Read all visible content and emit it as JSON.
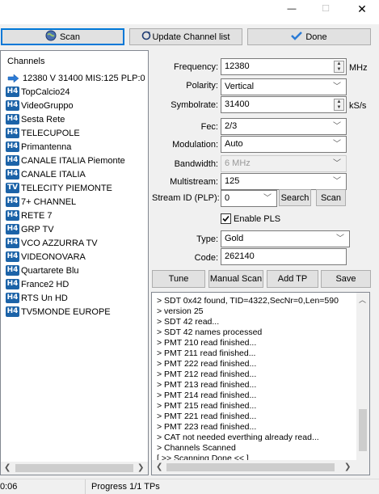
{
  "window": {
    "minimize_glyph": "—",
    "maximize_glyph": "☐",
    "close_glyph": "✕"
  },
  "toolbar": {
    "scan_label": "Scan",
    "update_label": "Update Channel list",
    "done_label": "Done"
  },
  "channels": {
    "header": "Channels",
    "transponder": "12380 V 31400 MIS:125 PLP:0",
    "items": [
      {
        "badge": "H4",
        "name": "TopCalcio24"
      },
      {
        "badge": "H4",
        "name": "VideoGruppo"
      },
      {
        "badge": "H4",
        "name": "Sesta Rete"
      },
      {
        "badge": "H4",
        "name": "TELECUPOLE"
      },
      {
        "badge": "H4",
        "name": "Primantenna"
      },
      {
        "badge": "H4",
        "name": "CANALE ITALIA Piemonte"
      },
      {
        "badge": "H4",
        "name": "CANALE ITALIA"
      },
      {
        "badge": "TV",
        "name": "TELECITY PIEMONTE"
      },
      {
        "badge": "H4",
        "name": "7+ CHANNEL"
      },
      {
        "badge": "H4",
        "name": "RETE 7"
      },
      {
        "badge": "H4",
        "name": "GRP TV"
      },
      {
        "badge": "H4",
        "name": "VCO AZZURRA TV"
      },
      {
        "badge": "H4",
        "name": "VIDEONOVARA"
      },
      {
        "badge": "H4",
        "name": "Quartarete Blu"
      },
      {
        "badge": "H4",
        "name": "France2 HD"
      },
      {
        "badge": "H4",
        "name": "RTS Un HD"
      },
      {
        "badge": "H4",
        "name": "TV5MONDE EUROPE"
      }
    ]
  },
  "form": {
    "frequency": {
      "label": "Frequency:",
      "value": "12380",
      "unit": "MHz"
    },
    "polarity": {
      "label": "Polarity:",
      "value": "Vertical"
    },
    "symbolrate": {
      "label": "Symbolrate:",
      "value": "31400",
      "unit": "kS/s"
    },
    "fec": {
      "label": "Fec:",
      "value": "2/3"
    },
    "modulation": {
      "label": "Modulation:",
      "value": "Auto"
    },
    "bandwidth": {
      "label": "Bandwidth:",
      "value": "6 MHz"
    },
    "multistream": {
      "label": "Multistream:",
      "value": "125"
    },
    "stream_id": {
      "label": "Stream ID (PLP):",
      "value": "0"
    },
    "search_label": "Search",
    "scan_label": "Scan",
    "enable_pls": {
      "label": "Enable PLS",
      "checked": true
    },
    "type": {
      "label": "Type:",
      "value": "Gold"
    },
    "code": {
      "label": "Code:",
      "value": "262140"
    }
  },
  "actions": {
    "tune": "Tune",
    "manual_scan": "Manual Scan",
    "add_tp": "Add TP",
    "save": "Save"
  },
  "log": {
    "lines": [
      ">    SDT 0x42 found, TID=4322,SecNr=0,Len=590",
      ">    version 25",
      ">    SDT 42 read...",
      ">    SDT 42 names processed",
      ">    PMT 210 read finished...",
      ">    PMT 211 read finished...",
      ">    PMT 222 read finished...",
      ">    PMT 212 read finished...",
      ">    PMT 213 read finished...",
      ">    PMT 214 read finished...",
      ">    PMT 215 read finished...",
      ">    PMT 221 read finished...",
      ">    PMT 223 read finished...",
      ">    CAT not needed everthing already read...",
      ">    Channels Scanned",
      "[ >> Scanning Done << ]"
    ]
  },
  "status": {
    "time": "0:06",
    "progress": "Progress 1/1 TPs"
  },
  "colors": {
    "badge": "#1c63a8",
    "focus_border": "#0078d7",
    "icon_blue": "#2b7bd6"
  }
}
